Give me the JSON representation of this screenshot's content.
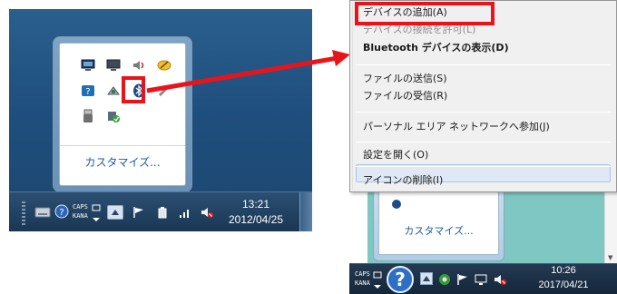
{
  "left": {
    "flyout": {
      "customize_label": "カスタマイズ...",
      "icons": [
        "network-computer-icon",
        "monitor-icon",
        "volume-icon",
        "satellite-dish-icon",
        "help-support-icon",
        "connection-icon",
        "bluetooth-icon",
        "pen-icon",
        "usb-drive-icon",
        "security-shield-icon"
      ]
    },
    "taskbar": {
      "caps": "CAPS",
      "kana": "KANA",
      "time": "13:21",
      "date": "2012/04/25",
      "icons": [
        "keyboard-icon",
        "help-icon",
        "ime-icon",
        "show-hidden-icons-button",
        "flag-icon",
        "power-icon",
        "signal-icon",
        "speaker-muted-icon"
      ]
    }
  },
  "context_menu": {
    "items": [
      {
        "label": "デバイスの追加(A)",
        "state": "highlighted"
      },
      {
        "label": "デバイスの接続を許可(L)",
        "state": "disabled"
      },
      {
        "label": "Bluetooth デバイスの表示(D)",
        "state": "default-bold"
      },
      {
        "label": "ファイルの送信(S)",
        "state": "normal"
      },
      {
        "label": "ファイルの受信(R)",
        "state": "normal"
      },
      {
        "label": "パーソナル エリア ネットワークへ参加(J)",
        "state": "normal"
      },
      {
        "label": "設定を開く(O)",
        "state": "normal"
      },
      {
        "label": "アイコンの削除(I)",
        "state": "hover"
      }
    ]
  },
  "right": {
    "flyout": {
      "customize_label": "カスタマイズ..."
    },
    "taskbar": {
      "caps": "CAPS",
      "kana": "KANA",
      "time": "10:26",
      "date": "2017/04/21"
    }
  },
  "colors": {
    "highlight_red": "#e8141a",
    "link_blue": "#1a5a9e",
    "desktop_blue": "#2a5f8e",
    "teal": "#7fc7c2"
  }
}
